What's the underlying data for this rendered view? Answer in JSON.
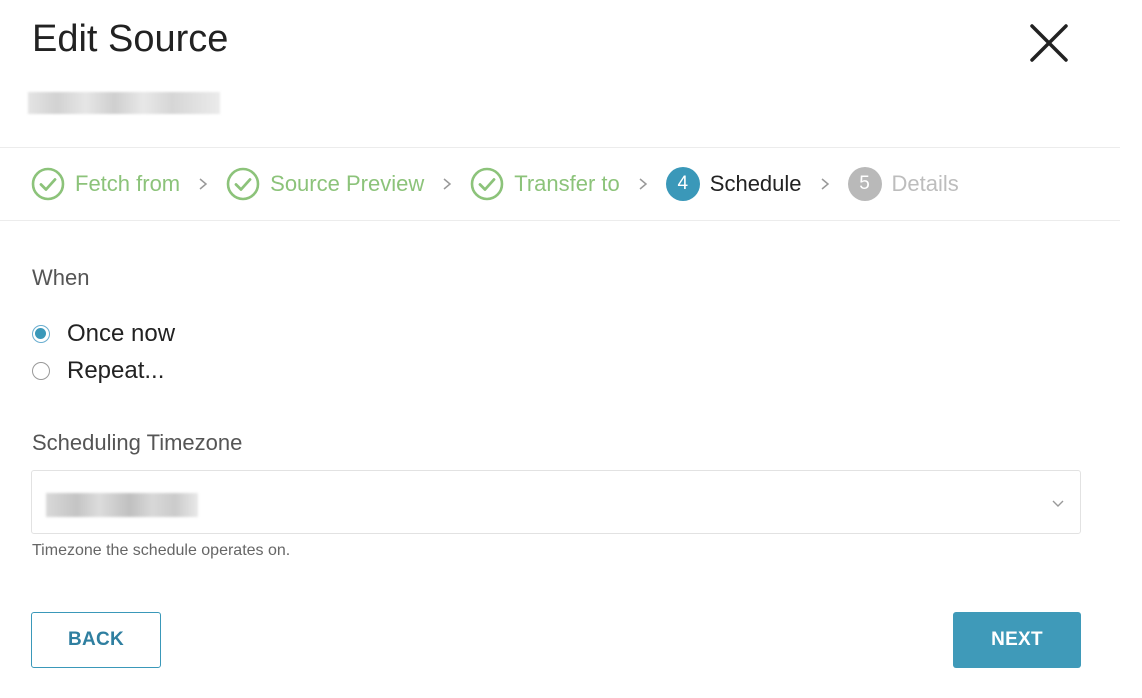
{
  "dialog": {
    "title": "Edit Source"
  },
  "steps": [
    {
      "label": "Fetch from",
      "state": "done"
    },
    {
      "label": "Source Preview",
      "state": "done"
    },
    {
      "label": "Transfer to",
      "state": "done"
    },
    {
      "number": "4",
      "label": "Schedule",
      "state": "current"
    },
    {
      "number": "5",
      "label": "Details",
      "state": "future"
    }
  ],
  "when": {
    "label": "When",
    "options": [
      {
        "label": "Once now",
        "checked": true
      },
      {
        "label": "Repeat...",
        "checked": false
      }
    ]
  },
  "timezone": {
    "label": "Scheduling Timezone",
    "help": "Timezone the schedule operates on."
  },
  "buttons": {
    "back": "BACK",
    "next": "NEXT"
  },
  "colors": {
    "accent": "#3a98b9",
    "done": "#8cc37a",
    "future": "#b9b9b9"
  },
  "icons": {
    "close": "close-icon",
    "check": "check-circle-icon",
    "separator": "chevron-right-icon",
    "dropdown": "chevron-down-icon"
  }
}
